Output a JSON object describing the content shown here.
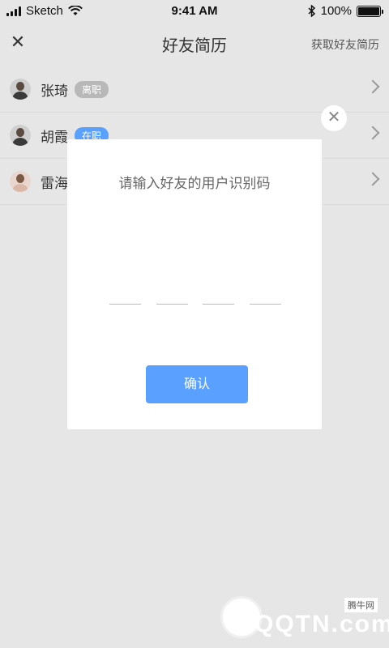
{
  "status_bar": {
    "carrier": "Sketch",
    "time": "9:41 AM",
    "battery": "100%",
    "battery_level": 1.0
  },
  "nav": {
    "close_icon": "close-icon",
    "title": "好友简历",
    "action": "获取好友简历"
  },
  "friends": [
    {
      "name": "张琦",
      "status": "离职",
      "status_type": "off"
    },
    {
      "name": "胡霞",
      "status": "在职",
      "status_type": "on"
    },
    {
      "name": "雷海",
      "status": "",
      "status_type": "none"
    }
  ],
  "dialog": {
    "title": "请输入好友的用户识别码",
    "code_slots": 4,
    "confirm_label": "确认"
  },
  "watermark": {
    "text": "QQTN.com",
    "sub": "腾牛网"
  },
  "colors": {
    "accent": "#5aa0ff",
    "background": "#e6e6e6"
  }
}
